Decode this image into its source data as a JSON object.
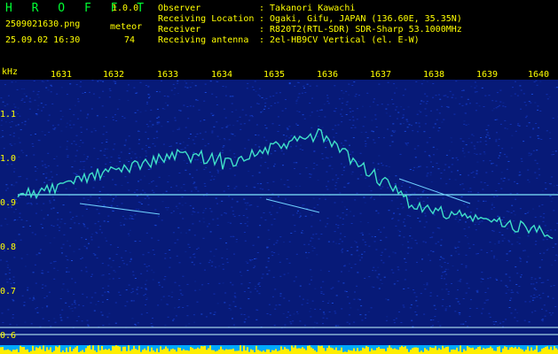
{
  "app": {
    "name": "H R O F F T",
    "version": "1.0.0"
  },
  "file": {
    "name": "2509021630.png",
    "datetime": "25.09.02 16:30"
  },
  "meteor": {
    "label": "meteor",
    "count": "74"
  },
  "info": {
    "observer_label": "Observer",
    "observer_value": ": Takanori Kawachi",
    "location_label": "Receiving Location",
    "location_value": ": Ogaki, Gifu, JAPAN (136.60E, 35.35N)",
    "receiver_label": "Receiver",
    "receiver_value": ": R820T2(RTL-SDR) SDR-Sharp 53.1000MHz",
    "antenna_label": "Receiving antenna",
    "antenna_value": ": 2el-HB9CV Vertical (el. E-W)"
  },
  "axis": {
    "unit": "kHz",
    "x_ticks": [
      "1631",
      "1632",
      "1633",
      "1634",
      "1635",
      "1636",
      "1637",
      "1638",
      "1639",
      "1640"
    ],
    "y_ticks": [
      "1.1",
      "1.0",
      "0.9",
      "0.8",
      "0.7",
      "0.6"
    ]
  },
  "colors": {
    "bg": "#000000",
    "noise": "#0a1f8a",
    "signal": "#37e0c0",
    "marker": "#ffff00",
    "baseline": "#00ccff"
  }
}
